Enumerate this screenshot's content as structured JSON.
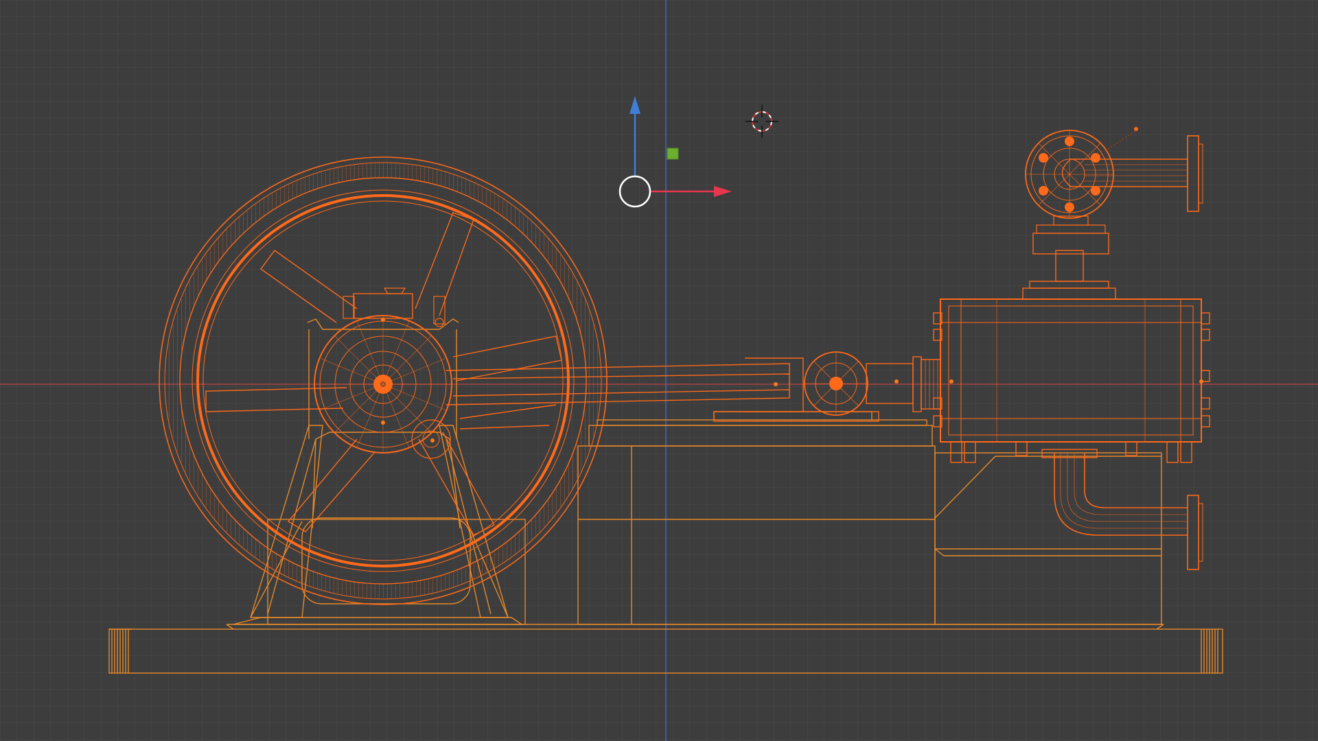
{
  "viewport": {
    "view": "front-orthographic-wireframe",
    "background_color": "#3d3d3d",
    "grid_color": "#4d4d4d",
    "axis_colors": {
      "x": "#c04545",
      "z": "#4a6fc2"
    }
  },
  "object_colors": {
    "selected_active": "#ff6a1a",
    "selected_inactive": "#e88a2a"
  },
  "gizmo": {
    "type": "translate",
    "colors": {
      "x": "#e8364e",
      "z": "#3f7fd6",
      "plane": "#6cae2d",
      "center": "#ffffff"
    }
  },
  "cursor": {
    "icon": "3d-cursor-icon",
    "colors": [
      "#d33",
      "#fff"
    ]
  },
  "model": {
    "parts": [
      "flywheel",
      "crank-housing",
      "connecting-rod",
      "crosshead",
      "cylinder",
      "steam-valve",
      "inlet-pipe",
      "exhaust-pipe",
      "frame-stand",
      "bed",
      "base-plate"
    ]
  }
}
